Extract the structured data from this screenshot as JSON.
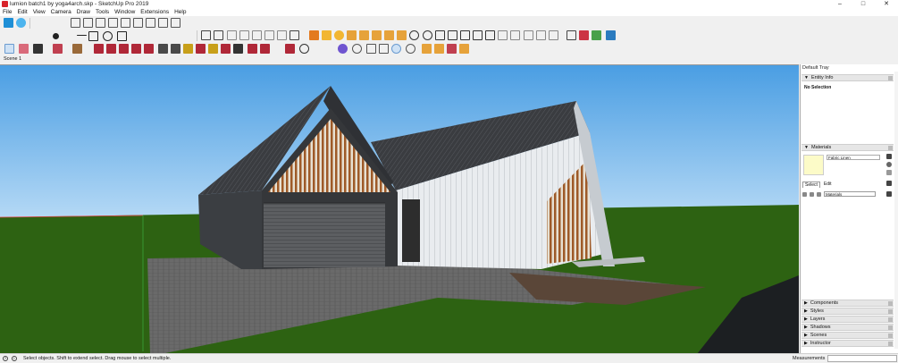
{
  "window": {
    "title": "lumion batch1 by yoga4arch.skp - SketchUp Pro 2019",
    "controls": {
      "minimize": "–",
      "maximize": "□",
      "close": "✕"
    }
  },
  "menu": [
    "File",
    "Edit",
    "View",
    "Camera",
    "Draw",
    "Tools",
    "Window",
    "Extensions",
    "Help"
  ],
  "scene_tab": "Scene 1",
  "tray": {
    "title": "Default Tray",
    "entity_info": {
      "header": "Entity Info",
      "selection": "No Selection"
    },
    "materials": {
      "header": "Materials",
      "current_name": "Fabric Linen",
      "swatch_color": "#fcfbc8",
      "tabs": [
        "Select",
        "Edit"
      ],
      "collection": "Materials"
    },
    "panels": [
      "Components",
      "Styles",
      "Layers",
      "Shadows",
      "Scenes",
      "Instructor"
    ]
  },
  "status": {
    "hint": "Select objects. Shift to extend select. Drag mouse to select multiple.",
    "measurements_label": "Measurements"
  },
  "colors": {
    "sky_top": "#4a9ee3",
    "sky_bottom": "#b9dbf6",
    "ground": "#2d6212",
    "accent": "#d8232a"
  }
}
